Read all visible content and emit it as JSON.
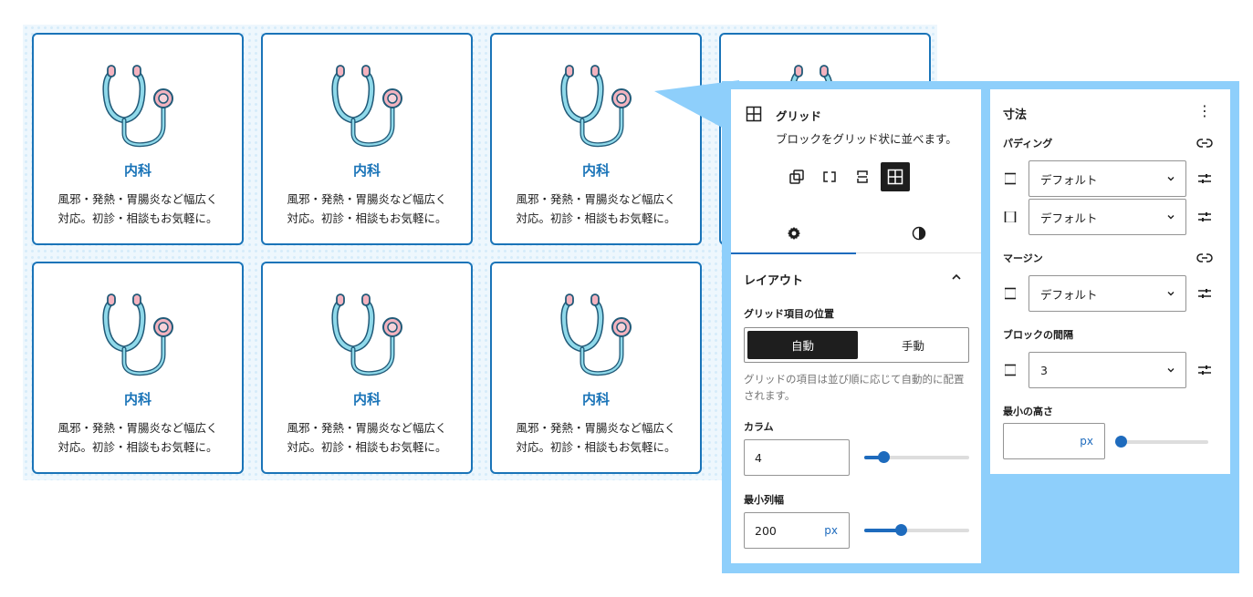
{
  "cards": [
    {
      "title": "内科",
      "line1": "風邪・発熱・胃腸炎など幅広く",
      "line2": "対応。初診・相談もお気軽に。"
    },
    {
      "title": "内科",
      "line1": "風邪・発熱・胃腸炎など幅広く",
      "line2": "対応。初診・相談もお気軽に。"
    },
    {
      "title": "内科",
      "line1": "風邪・発熱・胃腸炎など幅広く",
      "line2": "対応。初診・相談もお気軽に。"
    },
    {
      "title": "内科",
      "line1": "風邪・発熱・胃腸炎など幅広く",
      "line2": "対応。初診・相談もお気軽に。"
    },
    {
      "title": "内科",
      "line1": "風邪・発熱・胃腸炎など幅広く",
      "line2": "対応。初診・相談もお気軽に。"
    },
    {
      "title": "内科",
      "line1": "風邪・発熱・胃腸炎など幅広く",
      "line2": "対応。初診・相談もお気軽に。"
    },
    {
      "title": "",
      "line1": "",
      "line2": ""
    }
  ],
  "block": {
    "icon": "grid-icon",
    "name": "グリッド",
    "description": "ブロックをグリッド状に並べます。",
    "variations": [
      "group-icon",
      "row-icon",
      "stack-icon",
      "grid-icon"
    ],
    "active_variation": "grid-icon",
    "tabs": [
      {
        "icon": "gear-icon",
        "active": true
      },
      {
        "icon": "contrast-icon",
        "active": false
      }
    ]
  },
  "layout": {
    "title": "レイアウト",
    "position_label": "グリッド項目の位置",
    "options": [
      "自動",
      "手動"
    ],
    "selected_option": "自動",
    "help": "グリッドの項目は並び順に応じて自動的に配置されます。",
    "columns_label": "カラム",
    "columns_value": "4",
    "columns_slider_fraction": 0.18,
    "min_width_label": "最小列幅",
    "min_width_value": "200",
    "min_width_unit": "px",
    "min_width_slider_fraction": 0.35
  },
  "dimensions": {
    "title": "寸法",
    "menu_icon": "⋮",
    "padding_label": "パディング",
    "padding_rows": [
      {
        "side_icon": "vertical-sides-icon",
        "value": "デフォルト"
      },
      {
        "side_icon": "horizontal-sides-icon",
        "value": "デフォルト"
      }
    ],
    "margin_label": "マージン",
    "margin_rows": [
      {
        "side_icon": "vertical-sides-icon",
        "value": "デフォルト"
      }
    ],
    "gap_label": "ブロックの間隔",
    "gap_row": {
      "side_icon": "all-sides-icon",
      "value": "3"
    },
    "min_height_label": "最小の高さ",
    "min_height_value": "",
    "min_height_unit": "px",
    "min_height_slider_fraction": 0
  },
  "colors": {
    "accent": "#1e6bbd",
    "card_border": "#1a74b8",
    "callout": "#8ecffb",
    "grid_bg": "#eef7fd"
  }
}
